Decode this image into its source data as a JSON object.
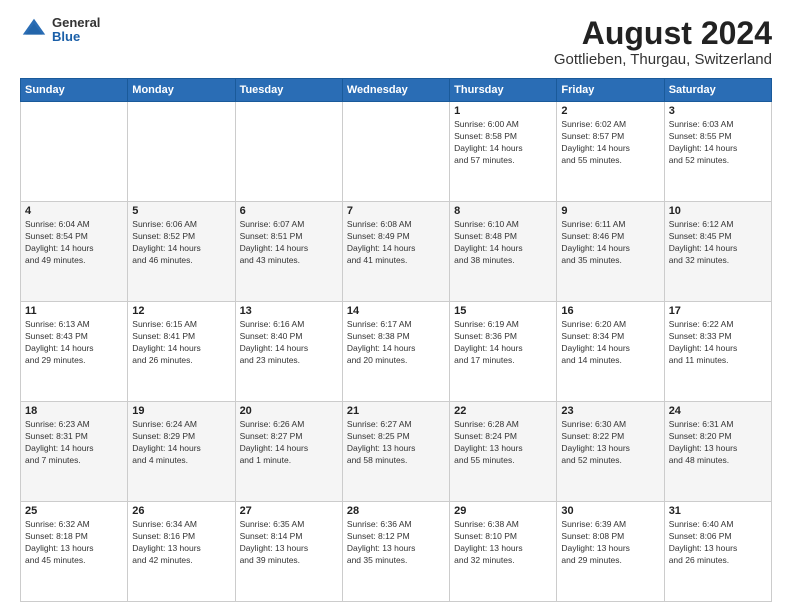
{
  "header": {
    "logo": {
      "line1": "General",
      "line2": "Blue"
    },
    "title": "August 2024",
    "subtitle": "Gottlieben, Thurgau, Switzerland"
  },
  "calendar": {
    "days_of_week": [
      "Sunday",
      "Monday",
      "Tuesday",
      "Wednesday",
      "Thursday",
      "Friday",
      "Saturday"
    ],
    "weeks": [
      [
        {
          "day": "",
          "info": ""
        },
        {
          "day": "",
          "info": ""
        },
        {
          "day": "",
          "info": ""
        },
        {
          "day": "",
          "info": ""
        },
        {
          "day": "1",
          "info": "Sunrise: 6:00 AM\nSunset: 8:58 PM\nDaylight: 14 hours\nand 57 minutes."
        },
        {
          "day": "2",
          "info": "Sunrise: 6:02 AM\nSunset: 8:57 PM\nDaylight: 14 hours\nand 55 minutes."
        },
        {
          "day": "3",
          "info": "Sunrise: 6:03 AM\nSunset: 8:55 PM\nDaylight: 14 hours\nand 52 minutes."
        }
      ],
      [
        {
          "day": "4",
          "info": "Sunrise: 6:04 AM\nSunset: 8:54 PM\nDaylight: 14 hours\nand 49 minutes."
        },
        {
          "day": "5",
          "info": "Sunrise: 6:06 AM\nSunset: 8:52 PM\nDaylight: 14 hours\nand 46 minutes."
        },
        {
          "day": "6",
          "info": "Sunrise: 6:07 AM\nSunset: 8:51 PM\nDaylight: 14 hours\nand 43 minutes."
        },
        {
          "day": "7",
          "info": "Sunrise: 6:08 AM\nSunset: 8:49 PM\nDaylight: 14 hours\nand 41 minutes."
        },
        {
          "day": "8",
          "info": "Sunrise: 6:10 AM\nSunset: 8:48 PM\nDaylight: 14 hours\nand 38 minutes."
        },
        {
          "day": "9",
          "info": "Sunrise: 6:11 AM\nSunset: 8:46 PM\nDaylight: 14 hours\nand 35 minutes."
        },
        {
          "day": "10",
          "info": "Sunrise: 6:12 AM\nSunset: 8:45 PM\nDaylight: 14 hours\nand 32 minutes."
        }
      ],
      [
        {
          "day": "11",
          "info": "Sunrise: 6:13 AM\nSunset: 8:43 PM\nDaylight: 14 hours\nand 29 minutes."
        },
        {
          "day": "12",
          "info": "Sunrise: 6:15 AM\nSunset: 8:41 PM\nDaylight: 14 hours\nand 26 minutes."
        },
        {
          "day": "13",
          "info": "Sunrise: 6:16 AM\nSunset: 8:40 PM\nDaylight: 14 hours\nand 23 minutes."
        },
        {
          "day": "14",
          "info": "Sunrise: 6:17 AM\nSunset: 8:38 PM\nDaylight: 14 hours\nand 20 minutes."
        },
        {
          "day": "15",
          "info": "Sunrise: 6:19 AM\nSunset: 8:36 PM\nDaylight: 14 hours\nand 17 minutes."
        },
        {
          "day": "16",
          "info": "Sunrise: 6:20 AM\nSunset: 8:34 PM\nDaylight: 14 hours\nand 14 minutes."
        },
        {
          "day": "17",
          "info": "Sunrise: 6:22 AM\nSunset: 8:33 PM\nDaylight: 14 hours\nand 11 minutes."
        }
      ],
      [
        {
          "day": "18",
          "info": "Sunrise: 6:23 AM\nSunset: 8:31 PM\nDaylight: 14 hours\nand 7 minutes."
        },
        {
          "day": "19",
          "info": "Sunrise: 6:24 AM\nSunset: 8:29 PM\nDaylight: 14 hours\nand 4 minutes."
        },
        {
          "day": "20",
          "info": "Sunrise: 6:26 AM\nSunset: 8:27 PM\nDaylight: 14 hours\nand 1 minute."
        },
        {
          "day": "21",
          "info": "Sunrise: 6:27 AM\nSunset: 8:25 PM\nDaylight: 13 hours\nand 58 minutes."
        },
        {
          "day": "22",
          "info": "Sunrise: 6:28 AM\nSunset: 8:24 PM\nDaylight: 13 hours\nand 55 minutes."
        },
        {
          "day": "23",
          "info": "Sunrise: 6:30 AM\nSunset: 8:22 PM\nDaylight: 13 hours\nand 52 minutes."
        },
        {
          "day": "24",
          "info": "Sunrise: 6:31 AM\nSunset: 8:20 PM\nDaylight: 13 hours\nand 48 minutes."
        }
      ],
      [
        {
          "day": "25",
          "info": "Sunrise: 6:32 AM\nSunset: 8:18 PM\nDaylight: 13 hours\nand 45 minutes."
        },
        {
          "day": "26",
          "info": "Sunrise: 6:34 AM\nSunset: 8:16 PM\nDaylight: 13 hours\nand 42 minutes."
        },
        {
          "day": "27",
          "info": "Sunrise: 6:35 AM\nSunset: 8:14 PM\nDaylight: 13 hours\nand 39 minutes."
        },
        {
          "day": "28",
          "info": "Sunrise: 6:36 AM\nSunset: 8:12 PM\nDaylight: 13 hours\nand 35 minutes."
        },
        {
          "day": "29",
          "info": "Sunrise: 6:38 AM\nSunset: 8:10 PM\nDaylight: 13 hours\nand 32 minutes."
        },
        {
          "day": "30",
          "info": "Sunrise: 6:39 AM\nSunset: 8:08 PM\nDaylight: 13 hours\nand 29 minutes."
        },
        {
          "day": "31",
          "info": "Sunrise: 6:40 AM\nSunset: 8:06 PM\nDaylight: 13 hours\nand 26 minutes."
        }
      ]
    ]
  }
}
